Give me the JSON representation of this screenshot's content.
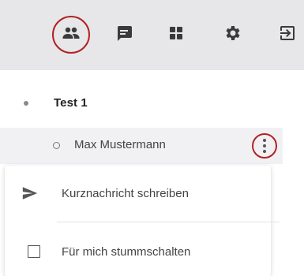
{
  "toolbar": {
    "buttons": [
      {
        "icon": "people-icon",
        "active": true
      },
      {
        "icon": "chat-icon",
        "active": false
      },
      {
        "icon": "apps-grid-icon",
        "active": false
      },
      {
        "icon": "gear-icon",
        "active": false
      },
      {
        "icon": "logout-icon",
        "active": false
      }
    ]
  },
  "section": {
    "title": "Test 1"
  },
  "member": {
    "name": "Max Mustermann",
    "menu_icon": "more-vertical-icon"
  },
  "context_menu": {
    "items": [
      {
        "label": "Kurznachricht schreiben",
        "icon": "send-icon"
      },
      {
        "label": "Für mich stummschalten",
        "icon": "checkbox-icon"
      }
    ]
  },
  "colors": {
    "toolbar_bg": "#e7e7ea",
    "row_bg": "#f1f1f4",
    "highlight_ring": "#b22222"
  }
}
